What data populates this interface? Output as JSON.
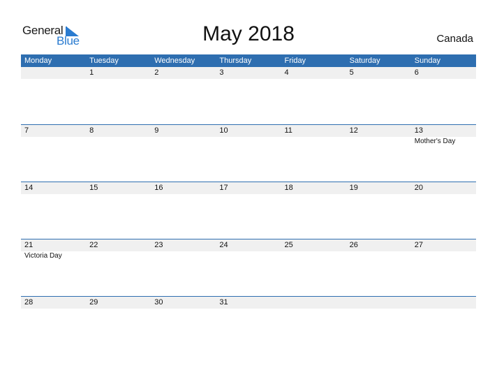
{
  "logo": {
    "general": "General",
    "blue": "Blue"
  },
  "title": "May 2018",
  "country": "Canada",
  "colors": {
    "accent": "#2e6eb0",
    "date_band": "#f0f0f0"
  },
  "weekdays": [
    "Monday",
    "Tuesday",
    "Wednesday",
    "Thursday",
    "Friday",
    "Saturday",
    "Sunday"
  ],
  "weeks": [
    {
      "days": [
        "",
        "1",
        "2",
        "3",
        "4",
        "5",
        "6"
      ],
      "events": [
        "",
        "",
        "",
        "",
        "",
        "",
        ""
      ]
    },
    {
      "days": [
        "7",
        "8",
        "9",
        "10",
        "11",
        "12",
        "13"
      ],
      "events": [
        "",
        "",
        "",
        "",
        "",
        "",
        "Mother's Day"
      ]
    },
    {
      "days": [
        "14",
        "15",
        "16",
        "17",
        "18",
        "19",
        "20"
      ],
      "events": [
        "",
        "",
        "",
        "",
        "",
        "",
        ""
      ]
    },
    {
      "days": [
        "21",
        "22",
        "23",
        "24",
        "25",
        "26",
        "27"
      ],
      "events": [
        "Victoria Day",
        "",
        "",
        "",
        "",
        "",
        ""
      ]
    },
    {
      "days": [
        "28",
        "29",
        "30",
        "31",
        "",
        "",
        ""
      ],
      "events": [
        "",
        "",
        "",
        "",
        "",
        "",
        ""
      ]
    }
  ]
}
